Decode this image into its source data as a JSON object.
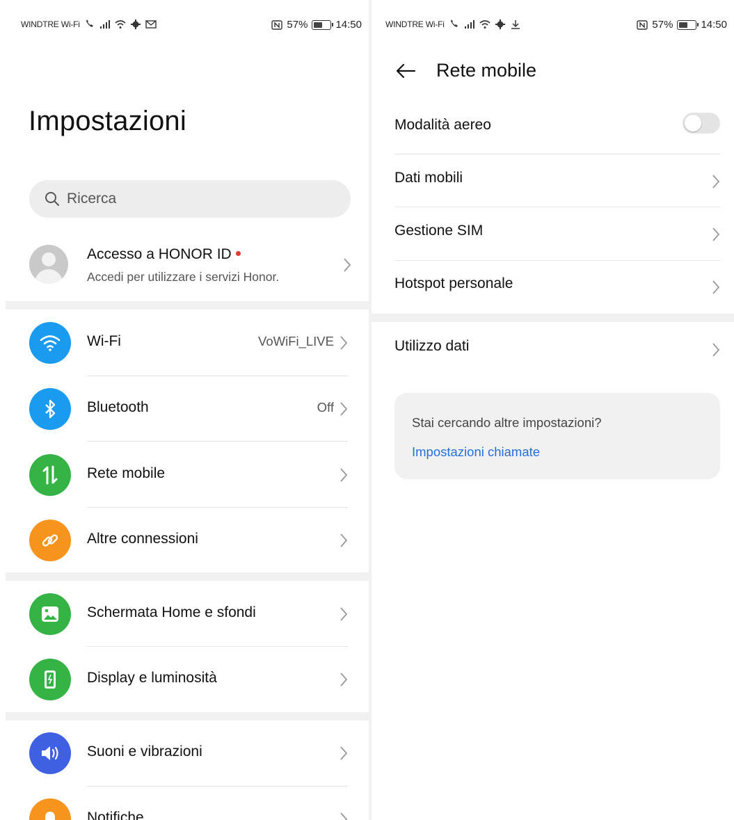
{
  "left": {
    "status": {
      "carrier": "WINDTRE Wi-Fi",
      "battery": "57%",
      "battery_level": 0.57,
      "time": "14:50"
    },
    "title": "Impostazioni",
    "search": {
      "placeholder": "Ricerca"
    },
    "account": {
      "title": "Accesso a HONOR ID",
      "subtitle": "Accedi per utilizzare i servizi Honor."
    },
    "items": [
      {
        "label": "Wi-Fi",
        "value": "VoWiFi_LIVE",
        "icon": "wifi-icon",
        "color": "#1a9bf0"
      },
      {
        "label": "Bluetooth",
        "value": "Off",
        "icon": "bluetooth-icon",
        "color": "#1a9bf0"
      },
      {
        "label": "Rete mobile",
        "value": "",
        "icon": "mobile-data-icon",
        "color": "#36b345"
      },
      {
        "label": "Altre connessioni",
        "value": "",
        "icon": "link-icon",
        "color": "#f7941d"
      },
      {
        "label": "Schermata Home e sfondi",
        "value": "",
        "icon": "image-icon",
        "color": "#36b345"
      },
      {
        "label": "Display e luminosità",
        "value": "",
        "icon": "brightness-icon",
        "color": "#36b345"
      },
      {
        "label": "Suoni e vibrazioni",
        "value": "",
        "icon": "speaker-icon",
        "color": "#3f60e0"
      },
      {
        "label": "Notifiche",
        "value": "",
        "icon": "bell-icon",
        "color": "#f7941d"
      }
    ]
  },
  "right": {
    "status": {
      "carrier": "WINDTRE Wi-Fi",
      "battery": "57%",
      "battery_level": 0.57,
      "time": "14:50"
    },
    "title": "Rete mobile",
    "rows": [
      {
        "label": "Modalità aereo",
        "control": "toggle-off"
      },
      {
        "label": "Dati mobili",
        "control": "chevron"
      },
      {
        "label": "Gestione SIM",
        "control": "chevron"
      },
      {
        "label": "Hotspot personale",
        "control": "chevron"
      },
      {
        "label": "Utilizzo dati",
        "control": "chevron"
      }
    ],
    "suggestion": {
      "question": "Stai cercando altre impostazioni?",
      "link": "Impostazioni chiamate"
    }
  },
  "colors": {
    "link": "#256fd9",
    "separator": "#e3e3e3",
    "band": "#f1f1f1",
    "notification_dot": "#e8392f"
  }
}
